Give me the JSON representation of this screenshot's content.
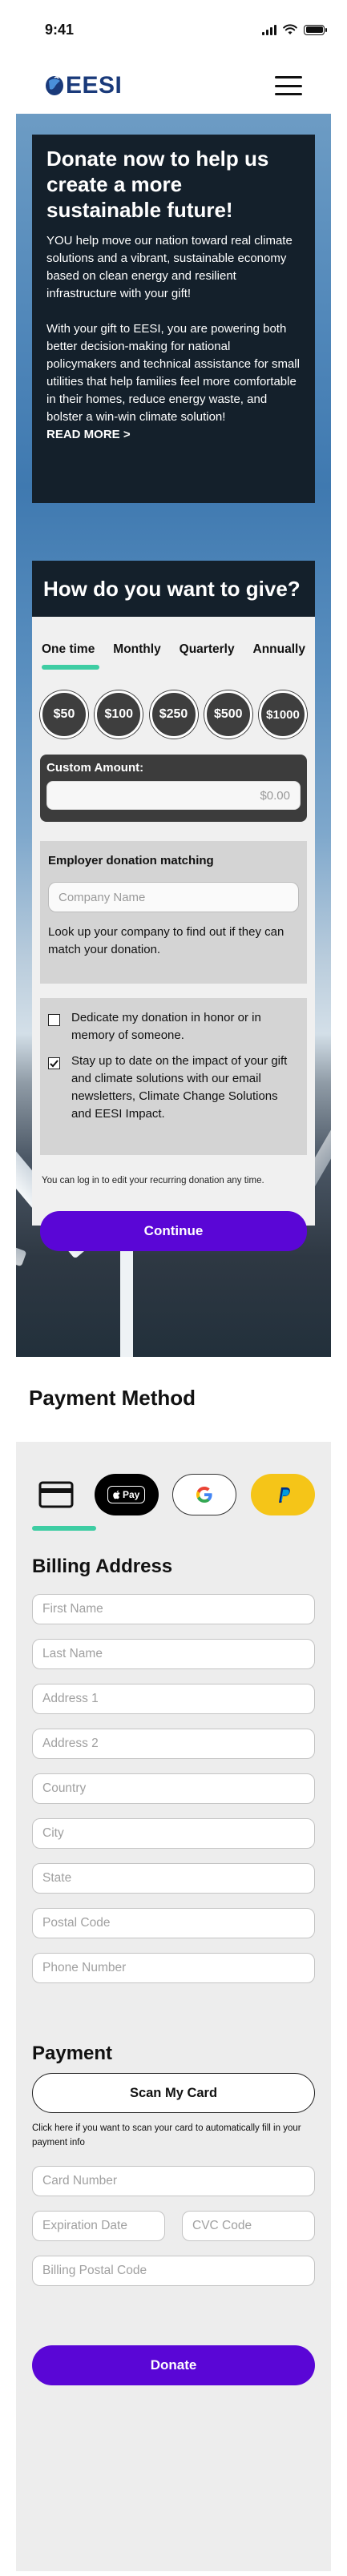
{
  "status_bar": {
    "time": "9:41",
    "icons": [
      "signal-icon",
      "wifi-icon",
      "battery-icon"
    ]
  },
  "header": {
    "logo_text": "EESI",
    "menu_icon": "hamburger-icon"
  },
  "intro": {
    "title": "Donate now to help us create a more sustainable future!",
    "paragraph_1": "YOU help move our nation toward real climate solutions and a vibrant, sustainable economy based on clean energy and resilient infrastructure with your gift!",
    "paragraph_2": "With your gift to EESI, you are powering both better decision-making for national policymakers and technical assistance for small utilities that help families feel more comfortable in their homes, reduce energy waste, and bolster a win-win climate solution!",
    "read_more": "READ MORE >"
  },
  "give": {
    "title": "How do you want to give?",
    "frequencies": [
      "One time",
      "Monthly",
      "Quarterly",
      "Annually"
    ],
    "selected_frequency": "One time",
    "amounts": [
      "$50",
      "$100",
      "$250",
      "$500",
      "$1000"
    ],
    "custom_label": "Custom Amount:",
    "custom_value": "$0.00",
    "employer_title": "Employer donation matching",
    "company_placeholder": "Company Name",
    "employer_text": "Look up your company to find out if they can match your donation.",
    "checks": [
      {
        "label": "Dedicate my donation in honor or in memory of someone.",
        "checked": false
      },
      {
        "label": "Stay up to date on the impact of your gift and climate solutions with our email newsletters, Climate Change Solutions and EESI Impact.",
        "checked": true
      }
    ],
    "recurring_note": "You can log in to edit your recurring donation any time.",
    "continue_label": "Continue"
  },
  "payment_method": {
    "title": "Payment Method",
    "methods": [
      "credit-card-icon",
      "apple-pay-icon",
      "google-pay-icon",
      "paypal-icon"
    ],
    "apple_pay_text": "Pay",
    "billing_title": "Billing Address",
    "billing_fields": [
      "First Name",
      "Last Name",
      "Address 1",
      "Address 2",
      "Country",
      "City",
      "State",
      "Postal Code",
      "Phone Number"
    ],
    "payment_title": "Payment",
    "scan_label": "Scan My Card",
    "scan_note": "Click here if you want to scan your card to automatically fill in your payment info",
    "card_number": "Card Number",
    "expiration": "Expiration Date",
    "cvc": "CVC Code",
    "billing_postal": "Billing Postal Code",
    "donate_label": "Donate"
  },
  "colors": {
    "primary": "#5a06d6",
    "accent": "#3ecda3",
    "dark_panel": "#14202b",
    "brand": "#1a3a7a",
    "paypal": "#f5c518"
  }
}
